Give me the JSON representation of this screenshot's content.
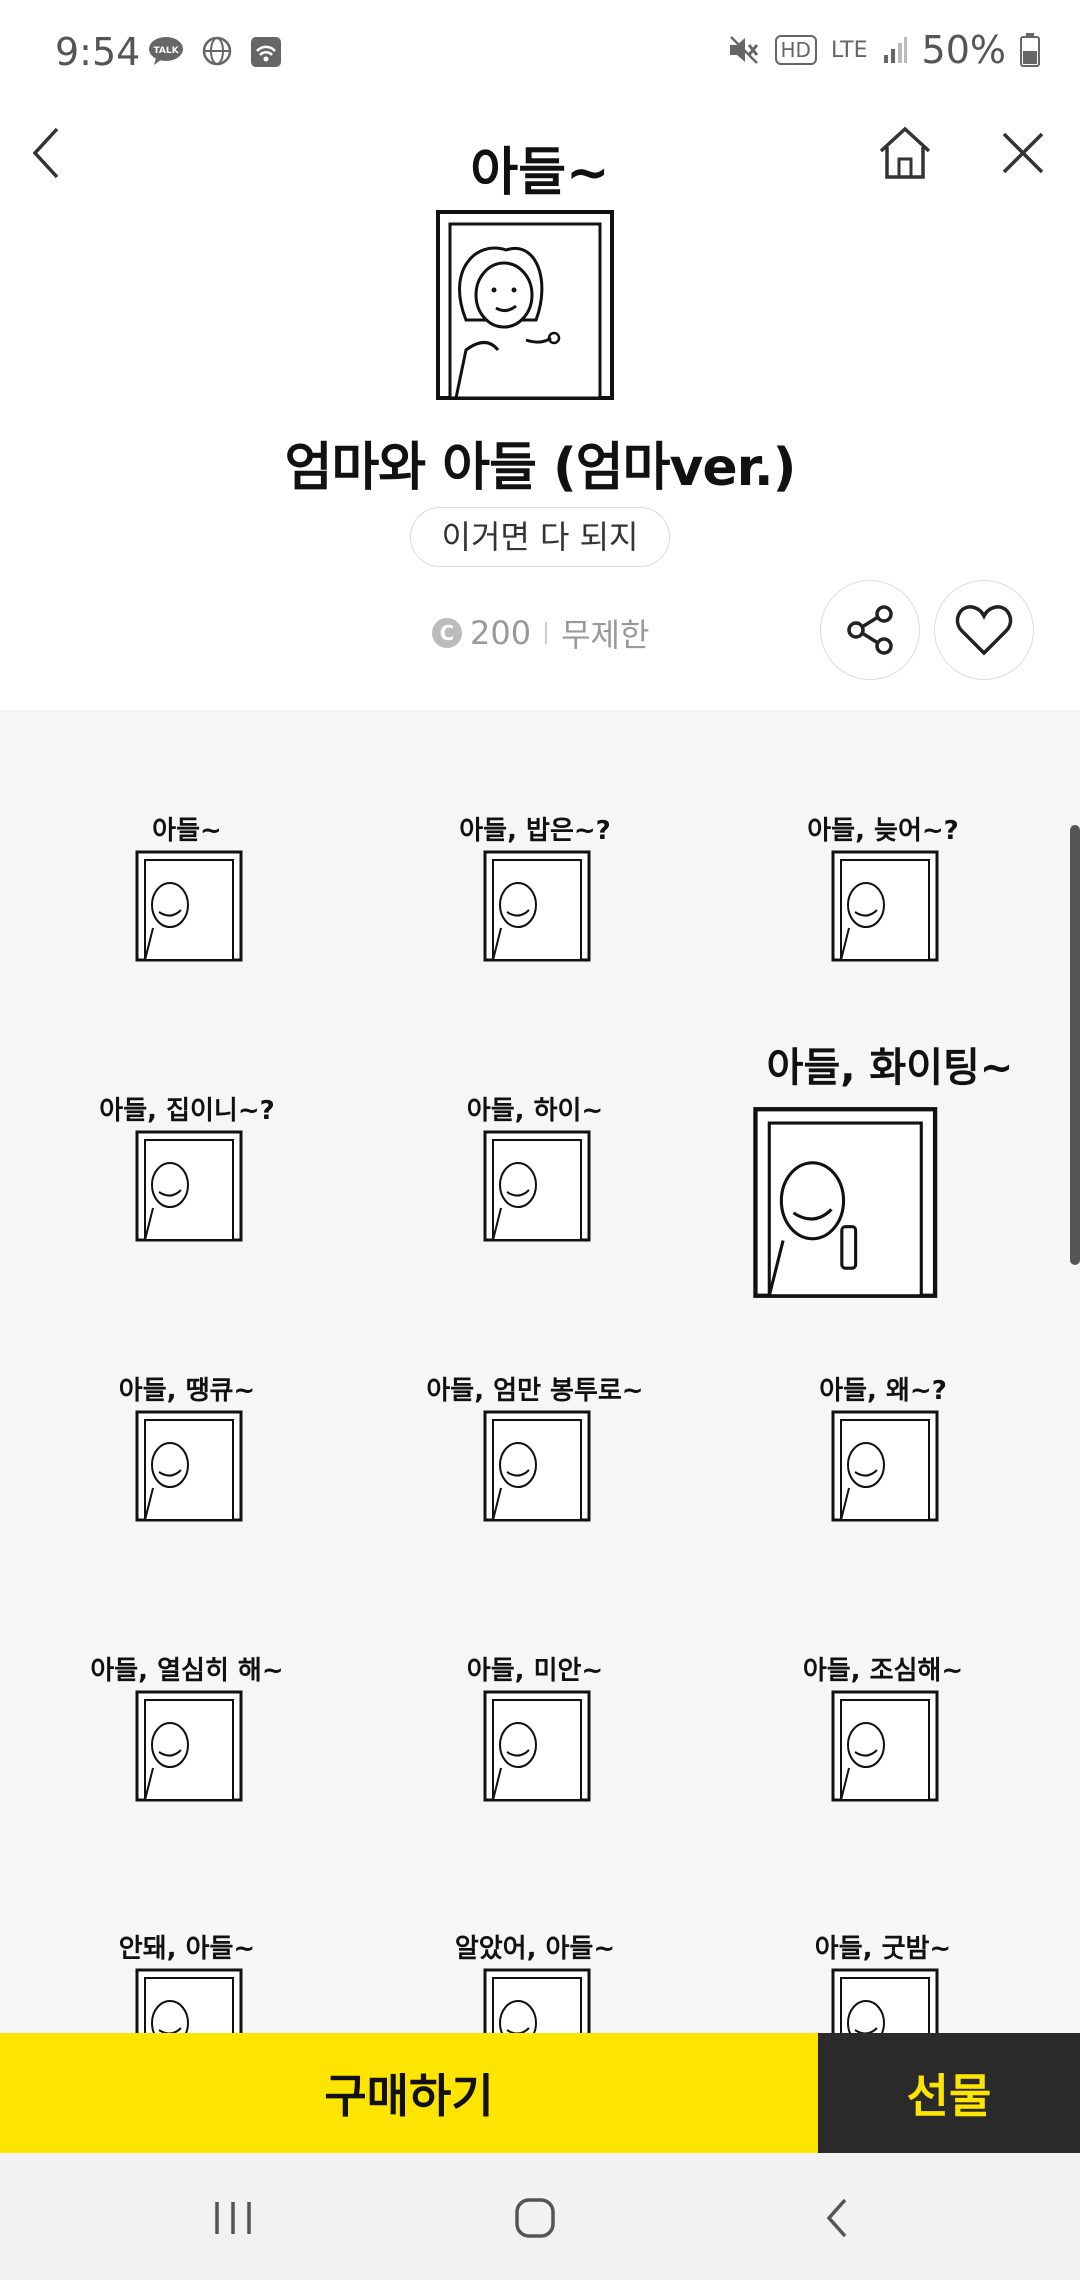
{
  "status_bar": {
    "time": "9:54",
    "network": "LTE",
    "hd": "HD",
    "battery": "50%"
  },
  "hero": {
    "caption": "아들~"
  },
  "product": {
    "title": "엄마와 아들 (엄마ver.)",
    "subtitle": "이거면 다 되지",
    "price": "200",
    "coin_symbol": "C",
    "duration": "무제한"
  },
  "stickers": [
    {
      "caption": "아들~"
    },
    {
      "caption": "아들, 밥은~?"
    },
    {
      "caption": "아들, 늦어~?"
    },
    {
      "caption": "아들, 집이니~?"
    },
    {
      "caption": "아들, 하이~"
    },
    {
      "caption": "아들, 화이팅~"
    },
    {
      "caption": "아들, 땡큐~"
    },
    {
      "caption": "아들, 엄만 봉투로~"
    },
    {
      "caption": "아들, 왜~?"
    },
    {
      "caption": "아들, 열심히 해~"
    },
    {
      "caption": "아들, 미안~"
    },
    {
      "caption": "아들, 조심해~"
    },
    {
      "caption": "안돼, 아들~"
    },
    {
      "caption": "알았어, 아들~"
    },
    {
      "caption": "아들, 굿밤~"
    }
  ],
  "actions": {
    "buy_label": "구매하기",
    "gift_label": "선물"
  },
  "colors": {
    "accent": "#fee500",
    "dark": "#2a2a2a"
  },
  "icons": [
    "back-icon",
    "home-icon",
    "close-icon",
    "share-icon",
    "heart-icon"
  ]
}
